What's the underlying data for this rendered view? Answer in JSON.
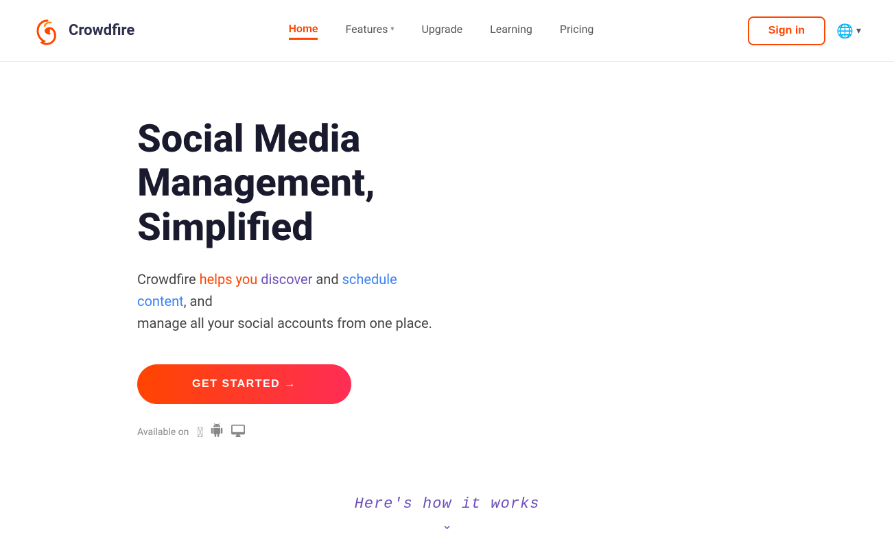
{
  "brand": {
    "logo_text": "Crowdfire",
    "logo_icon_alt": "crowdfire-logo"
  },
  "navbar": {
    "links": [
      {
        "id": "home",
        "label": "Home",
        "active": true,
        "has_dropdown": false
      },
      {
        "id": "features",
        "label": "Features",
        "active": false,
        "has_dropdown": true
      },
      {
        "id": "upgrade",
        "label": "Upgrade",
        "active": false,
        "has_dropdown": false
      },
      {
        "id": "learning",
        "label": "Learning",
        "active": false,
        "has_dropdown": false
      },
      {
        "id": "pricing",
        "label": "Pricing",
        "active": false,
        "has_dropdown": false
      }
    ],
    "sign_in_label": "Sign in",
    "lang_icon": "🌐",
    "lang_chevron": "▾"
  },
  "hero": {
    "title": "Social Media Management, Simplified",
    "subtitle_text": "Crowdfire helps you discover and schedule content, and manage all your social accounts from one place.",
    "cta_label": "GET STARTED →",
    "available_label": "Available on"
  },
  "how_it_works": {
    "text": "Here's how it works",
    "chevron": "⌄"
  },
  "colors": {
    "accent_red": "#ff4500",
    "accent_purple": "#6b4fbb",
    "accent_blue": "#3b82f6",
    "dark": "#1a1a2e",
    "text": "#444444"
  }
}
